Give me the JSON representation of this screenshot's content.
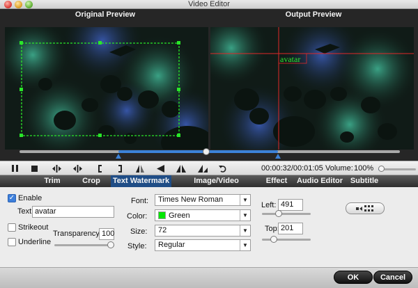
{
  "window": {
    "title": "Video Editor"
  },
  "preview": {
    "original_label": "Original Preview",
    "output_label": "Output Preview",
    "watermark_text_on_output": "avatar"
  },
  "timeline": {
    "selection_start": 0.26,
    "selection_end": 0.68,
    "playhead": 0.49
  },
  "controls": {
    "timecode": "00:00:32/00:01:05",
    "volume_label": "Volume:",
    "volume_value": "100%",
    "volume_level": 0.08,
    "icons": [
      "pause-icon",
      "stop-icon",
      "prev-frame-icon",
      "next-frame-icon",
      "trim-start-icon",
      "trim-end-icon",
      "flip-horizontal-icon",
      "rotate-left-icon",
      "flip-vertical-icon",
      "rotate-right-icon",
      "undo-icon"
    ]
  },
  "tabs": [
    "Trim",
    "Crop",
    "Text Watermark",
    "Image/Video Watermark",
    "Effect",
    "Audio Editor",
    "Subtitle"
  ],
  "active_tab": "Text Watermark",
  "watermark": {
    "enable_label": "Enable",
    "enable_checked": true,
    "text_label": "Text:",
    "text_value": "avatar",
    "strikeout_label": "Strikeout",
    "underline_label": "Underline",
    "transparency_label": "Transparency:",
    "transparency_value": "100",
    "transparency_level": 1.0,
    "font_label": "Font:",
    "font_value": "Times New Roman",
    "color_label": "Color:",
    "color_value": "Green",
    "color_swatch": "#00e600",
    "size_label": "Size:",
    "size_value": "72",
    "style_label": "Style:",
    "style_value": "Regular",
    "left_label": "Left:",
    "left_value": "491",
    "left_level": 0.32,
    "top_label": "Top:",
    "top_value": "201",
    "top_level": 0.2
  },
  "footer": {
    "ok_label": "OK",
    "cancel_label": "Cancel"
  },
  "colors": {
    "accent": "#3c82d8",
    "active_tab": "#1f4d86",
    "crop_frame": "#29e629",
    "guide_line": "#e02828"
  }
}
